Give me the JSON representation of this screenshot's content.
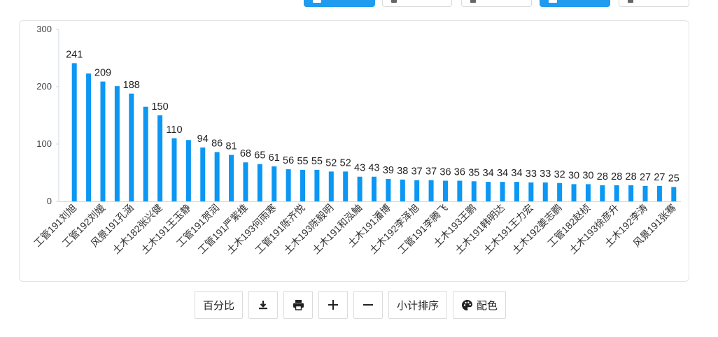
{
  "toolbar": {
    "percent_label": "百分比",
    "sort_label": "小计排序",
    "color_label": "配色"
  },
  "icons": {
    "download": "download-icon",
    "print": "print-icon",
    "zoom_in": "plus-icon",
    "zoom_out": "minus-icon",
    "palette": "palette-icon"
  },
  "colors": {
    "bar": "#0b97f3",
    "accent": "#1f9bf0"
  },
  "chart_data": {
    "type": "bar",
    "title": "",
    "xlabel": "",
    "ylabel": "",
    "ylim": [
      0,
      300
    ],
    "yticks": [
      0,
      100,
      200,
      300
    ],
    "categories": [
      "工管191刘旭",
      "",
      "工管192刘媛",
      "",
      "风景191孔涵",
      "",
      "土木182张兴健",
      "",
      "土木191王玉静",
      "",
      "工管191贺润",
      "",
      "工管191严紫维",
      "",
      "土木193何雨寒",
      "",
      "工管191陈齐悦",
      "",
      "土木193陈毅明",
      "",
      "土木191和泓鮋",
      "",
      "土木191潘博",
      "",
      "土木192李泽旭",
      "",
      "工管191李腾飞",
      "",
      "土木193王鹏",
      "",
      "土木191韩明达",
      "",
      "土木191王力宏",
      "",
      "土木192姜志鹏",
      "",
      "工管182赵桢",
      "",
      "土木193徐彦升",
      "",
      "土木192李涛",
      "",
      "风景191张骞"
    ],
    "values": [
      241,
      223,
      209,
      201,
      188,
      165,
      150,
      110,
      107,
      94,
      86,
      81,
      68,
      65,
      61,
      56,
      55,
      55,
      52,
      52,
      43,
      43,
      39,
      38,
      37,
      37,
      36,
      36,
      35,
      34,
      34,
      34,
      33,
      33,
      32,
      30,
      30,
      28,
      28,
      28,
      27,
      27,
      25
    ],
    "value_labels": [
      "241",
      "",
      "209",
      "",
      "188",
      "",
      "150",
      "110",
      "",
      "94",
      "86",
      "81",
      "68",
      "65",
      "61",
      "56",
      "55",
      "55",
      "52",
      "52",
      "43",
      "43",
      "39",
      "38",
      "37",
      "37",
      "36",
      "36",
      "35",
      "34",
      "34",
      "34",
      "33",
      "33",
      "32",
      "30",
      "30",
      "28",
      "28",
      "28",
      "27",
      "27",
      "25"
    ],
    "grid": false,
    "legend": "none"
  }
}
